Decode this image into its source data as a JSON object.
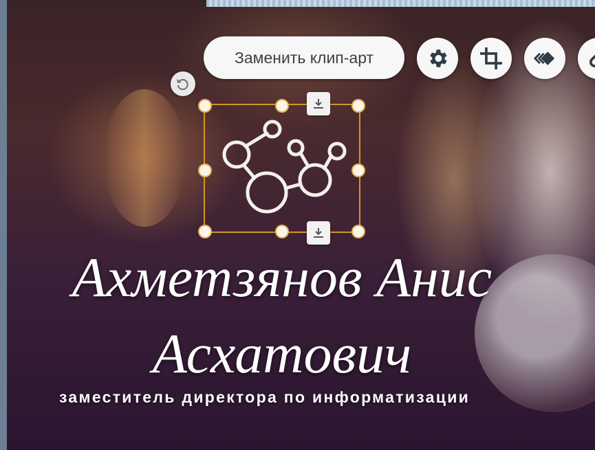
{
  "toolbar": {
    "replace_clipart_label": "Заменить клип-арт",
    "icons": [
      "gear-icon",
      "crop-icon",
      "layer-order-icon",
      "link-icon"
    ]
  },
  "canvas": {
    "name_line1": "Ахметзянов Анис",
    "name_line2": "Асхатович",
    "position": "заместитель директора по информатизации"
  },
  "colors": {
    "selection": "#d5961f",
    "button_bg": "#f7f7f7",
    "icon": "#2f3c45"
  }
}
